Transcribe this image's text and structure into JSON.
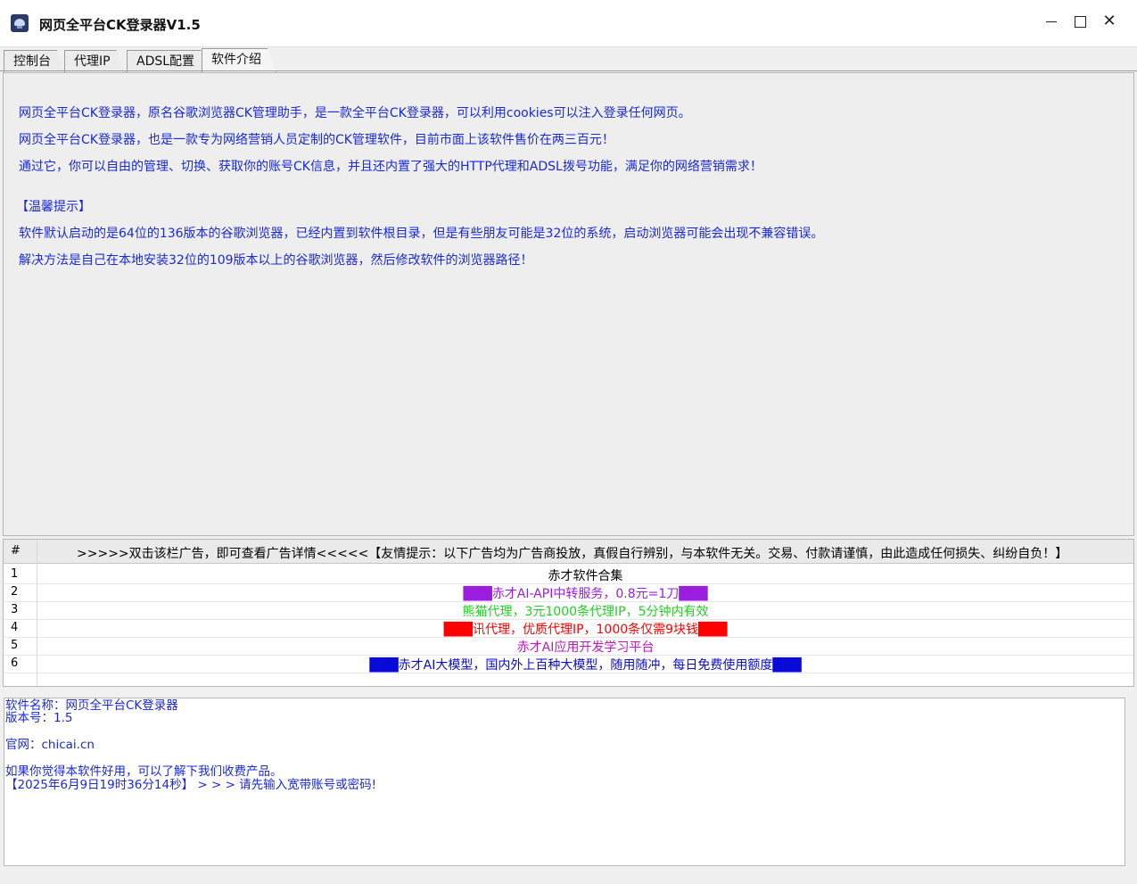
{
  "window": {
    "title": "网页全平台CK登录器V1.5",
    "controls": {
      "minimize": "minimize-icon",
      "maximize": "maximize-icon",
      "close": "close-icon",
      "close_glyph": "✕"
    }
  },
  "tabs": [
    {
      "label": "控制台",
      "active": false
    },
    {
      "label": "代理IP",
      "active": false
    },
    {
      "label": "ADSL配置",
      "active": false
    },
    {
      "label": "软件介绍",
      "active": true
    }
  ],
  "intro": {
    "color": "#1a29d9",
    "lines": [
      "网页全平台CK登录器，原名谷歌浏览器CK管理助手，是一款全平台CK登录器，可以利用cookies可以注入登录任何网页。",
      "网页全平台CK登录器，也是一款专为网络营销人员定制的CK管理软件，目前市面上该软件售价在两三百元！",
      "通过它，你可以自由的管理、切换、获取你的账号CK信息，并且还内置了强大的HTTP代理和ADSL拨号功能，满足你的网络营销需求！",
      "【温馨提示】",
      "软件默认启动的是64位的136版本的谷歌浏览器，已经内置到软件根目录，但是有些朋友可能是32位的系统，启动浏览器可能会出现不兼容错误。",
      "解决方法是自己在本地安装32位的109版本以上的谷歌浏览器，然后修改软件的浏览器路径！"
    ]
  },
  "ads": {
    "header_num": "#",
    "header_text": ">>>>>双击该栏广告，即可查看广告详情<<<<<【友情提示：以下广告均为广告商投放，真假自行辨别，与本软件无关。交易、付款请谨慎，由此造成任何损失、纠纷自负！】",
    "rows": [
      {
        "num": "1",
        "text": "赤才软件合集",
        "color": "#000000"
      },
      {
        "num": "2",
        "text": "███赤才AI-API中转服务，0.8元=1刀███",
        "color": "#9b1ee0"
      },
      {
        "num": "3",
        "text": "熊猫代理，3元1000条代理IP，5分钟内有效",
        "color": "#22d022"
      },
      {
        "num": "4",
        "text": "███讯代理，优质代理IP，1000条仅需9块钱███",
        "color": "#ff0000"
      },
      {
        "num": "5",
        "text": "赤才AI应用开发学习平台",
        "color": "#c018c0"
      },
      {
        "num": "6",
        "text": "███赤才AI大模型，国内外上百种大模型，随用随冲，每日免费使用额度███",
        "color": "#0a0ad8"
      }
    ]
  },
  "log": {
    "color": "#1a29d9",
    "lines": [
      "软件名称：网页全平台CK登录器",
      "版本号：1.5",
      "官网：chicai.cn",
      "如果你觉得本软件好用，可以了解下我们收费产品。",
      "【2025年6月9日19时36分14秒】 > > >  请先输入宽带账号或密码!"
    ]
  }
}
